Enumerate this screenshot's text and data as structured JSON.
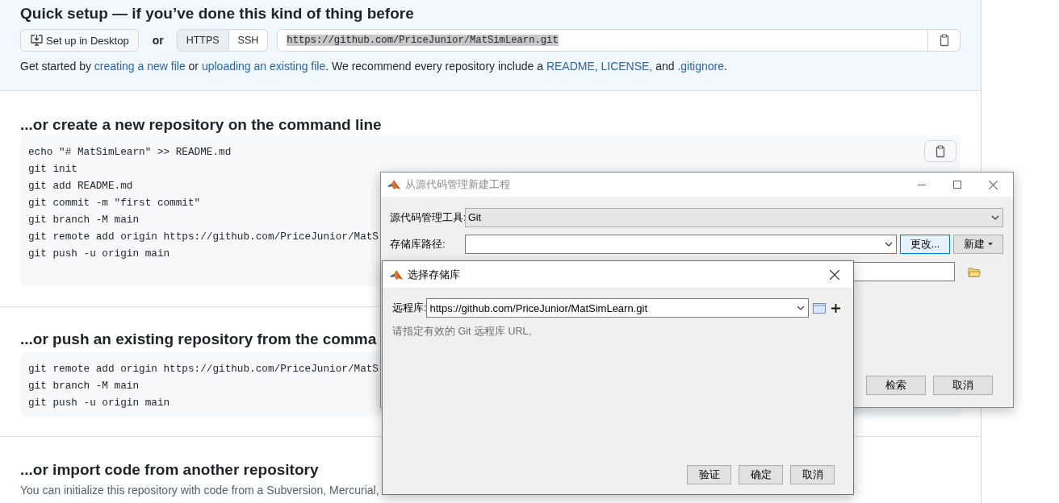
{
  "quick_setup": {
    "title": "Quick setup — if you’ve done this kind of thing before",
    "desktop_button": "Set up in Desktop",
    "or_label": "or",
    "protocols": [
      {
        "label": "HTTPS",
        "selected": true
      },
      {
        "label": "SSH",
        "selected": false
      }
    ],
    "clone_field": {
      "value": "https://github.com/PriceJunior/MatSimLearn.git",
      "highlighted": true
    },
    "description": [
      {
        "kind": "text",
        "text": "Get started by "
      },
      {
        "kind": "link",
        "text": "creating a new file"
      },
      {
        "kind": "text",
        "text": " or "
      },
      {
        "kind": "link",
        "text": "uploading an existing file"
      },
      {
        "kind": "text",
        "text": ". We recommend every repository include a "
      },
      {
        "kind": "link",
        "text": "README,"
      },
      {
        "kind": "link",
        "text": "LICENSE,"
      },
      {
        "kind": "text",
        "text": " and "
      },
      {
        "kind": "link",
        "text": ".gitignore"
      },
      {
        "kind": "text",
        "text": "."
      }
    ]
  },
  "sections": [
    {
      "kind": "code",
      "heading": "...or create a new repository on the command line",
      "copyable": true,
      "code_lines": [
        "echo \"# MatSimLearn\" >> README.md",
        "git init",
        "git add README.md",
        "git commit -m \"first commit\"",
        "git branch -M main",
        "git remote add origin https://github.com/PriceJunior/MatS",
        "git push -u origin main"
      ]
    },
    {
      "kind": "code",
      "heading": "...or push an existing repository from the comma",
      "code_lines": [
        "git remote add origin https://github.com/PriceJunior/MatS",
        "git branch -M main",
        "git push -u origin main"
      ]
    },
    {
      "kind": "text",
      "heading": "...or import code from another repository",
      "text": "You can initialize this repository with code from a Subversion, Mercurial,"
    }
  ],
  "back_dialog": {
    "title": "从源代码管理新建工程",
    "rows": [
      {
        "kind": "dropdown",
        "label": "源代码管理工具:",
        "value": "Git"
      },
      {
        "kind": "combo",
        "label": "存储库路径:",
        "buttons": [
          {
            "label": "更改...",
            "focused": true,
            "menu": false
          },
          {
            "label": "新建",
            "focused": false,
            "menu": true
          }
        ]
      },
      {
        "kind": "folder_field"
      }
    ],
    "buttons": [
      "检索",
      "取消"
    ]
  },
  "front_dialog": {
    "title": "选择存储库",
    "label": "远程库:",
    "value": "https://github.com/PriceJunior/MatSimLearn.git",
    "hint": "请指定有效的 Git 远程库 URL。",
    "buttons": [
      "验证",
      "确定",
      "取消"
    ]
  }
}
